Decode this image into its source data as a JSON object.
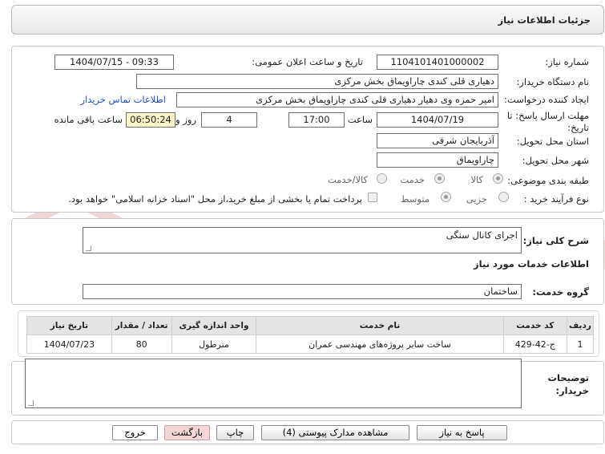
{
  "header": {
    "title": "جزئیات اطلاعات نیاز"
  },
  "form": {
    "need_number_label": "شماره نیاز:",
    "need_number": "1104101401000002",
    "announce_label": "تاریخ و ساعت اعلان عمومی:",
    "announce_value": "1404/07/15 - 09:33",
    "buyer_org_label": "نام دستگاه خریدار:",
    "buyer_org": "دهیاری قلی کندی چاراویماق بخش مرکزی",
    "creator_label": "ایجاد کننده درخواست:",
    "creator": "امیر حمزه وی دهیار دهیاری قلی کندی چاراویماق بخش مرکزی",
    "contact_link": "اطلاعات تماس خریدار",
    "deadline_label_line1": "مهلت ارسال پاسخ: تا",
    "deadline_label_line2": "تاریخ:",
    "deadline_date": "1404/07/19",
    "time_label": "ساعت",
    "deadline_time": "17:00",
    "days_value": "4",
    "days_label": "روز و",
    "remaining_time": "06:50:24",
    "remaining_label": "ساعت باقی مانده",
    "province_label": "استان محل تحویل:",
    "province": "آذربایجان شرقی",
    "city_label": "شهر محل تحویل:",
    "city": "چاراویماق",
    "category_label": "طبقه بندی موضوعی:",
    "category_options": [
      "کالا",
      "خدمت",
      "کالا/خدمت"
    ],
    "process_label": "نوع فرآیند خرید :",
    "process_options": [
      "جزیی",
      "متوسط"
    ],
    "payment_note": "پرداخت تمام یا بخشی از مبلغ خرید،از محل \"اسناد خزانه اسلامی\" خواهد بود."
  },
  "summary": {
    "label": "شرح کلی نیاز:",
    "value": "اجرای کانال سنگی"
  },
  "services": {
    "section_title": "اطلاعات خدمات مورد نیاز",
    "group_label": "گروه خدمت:",
    "group_value": "ساختمان",
    "columns": [
      "ردیف",
      "کد خدمت",
      "نام خدمت",
      "واحد اندازه گیری",
      "تعداد / مقدار",
      "تاریخ نیاز"
    ],
    "rows": [
      [
        "1",
        "ج-42-429",
        "ساخت سایر پروژه‌های مهندسی عمران",
        "مترطول",
        "80",
        "1404/07/23"
      ]
    ]
  },
  "buyer_notes": {
    "label_line1": "توضیحات",
    "label_line2": "خریدار:",
    "value": ""
  },
  "buttons": {
    "reply": "پاسخ به نیاز",
    "attachments": "مشاهده مدارک پیوستی (4)",
    "print": "چاپ",
    "back": "بازگشت",
    "exit": "خروج"
  },
  "watermark": {
    "text": "AriaTender.net"
  },
  "colors": {
    "link": "#1f4fc4",
    "remaining_bg": "#fff6c7",
    "back_button_bg": "#f5d6d6",
    "watermark": "#e9b6b6"
  }
}
